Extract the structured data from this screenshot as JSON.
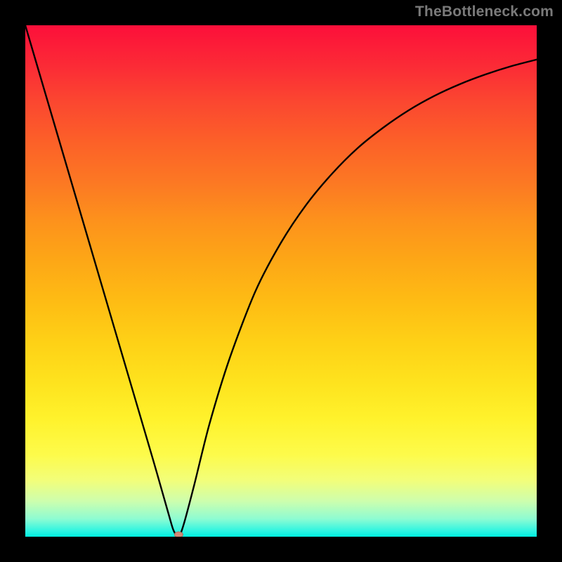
{
  "watermark": "TheBottleneck.com",
  "chart_data": {
    "type": "line",
    "title": "",
    "xlabel": "",
    "ylabel": "",
    "xlim": [
      0,
      100
    ],
    "ylim": [
      0,
      100
    ],
    "grid": false,
    "legend": false,
    "series": [
      {
        "name": "bottleneck-curve",
        "x": [
          0,
          5,
          10,
          15,
          20,
          25,
          28,
          29,
          30,
          31,
          33,
          36,
          40,
          45,
          50,
          55,
          60,
          65,
          70,
          75,
          80,
          85,
          90,
          95,
          100
        ],
        "y": [
          100,
          83,
          66,
          49,
          32,
          15,
          4.5,
          1.2,
          0,
          2.5,
          10,
          22,
          35,
          48,
          57.5,
          65,
          71,
          76,
          80,
          83.4,
          86.2,
          88.5,
          90.4,
          92,
          93.3
        ]
      }
    ],
    "annotations": [
      {
        "type": "marker",
        "name": "minimum-point",
        "x": 30,
        "y": 0,
        "color": "#d08a78"
      }
    ],
    "background_gradient": {
      "top": "#fd0f3a",
      "mid": "#fed116",
      "bottom": "#00eee0"
    }
  }
}
